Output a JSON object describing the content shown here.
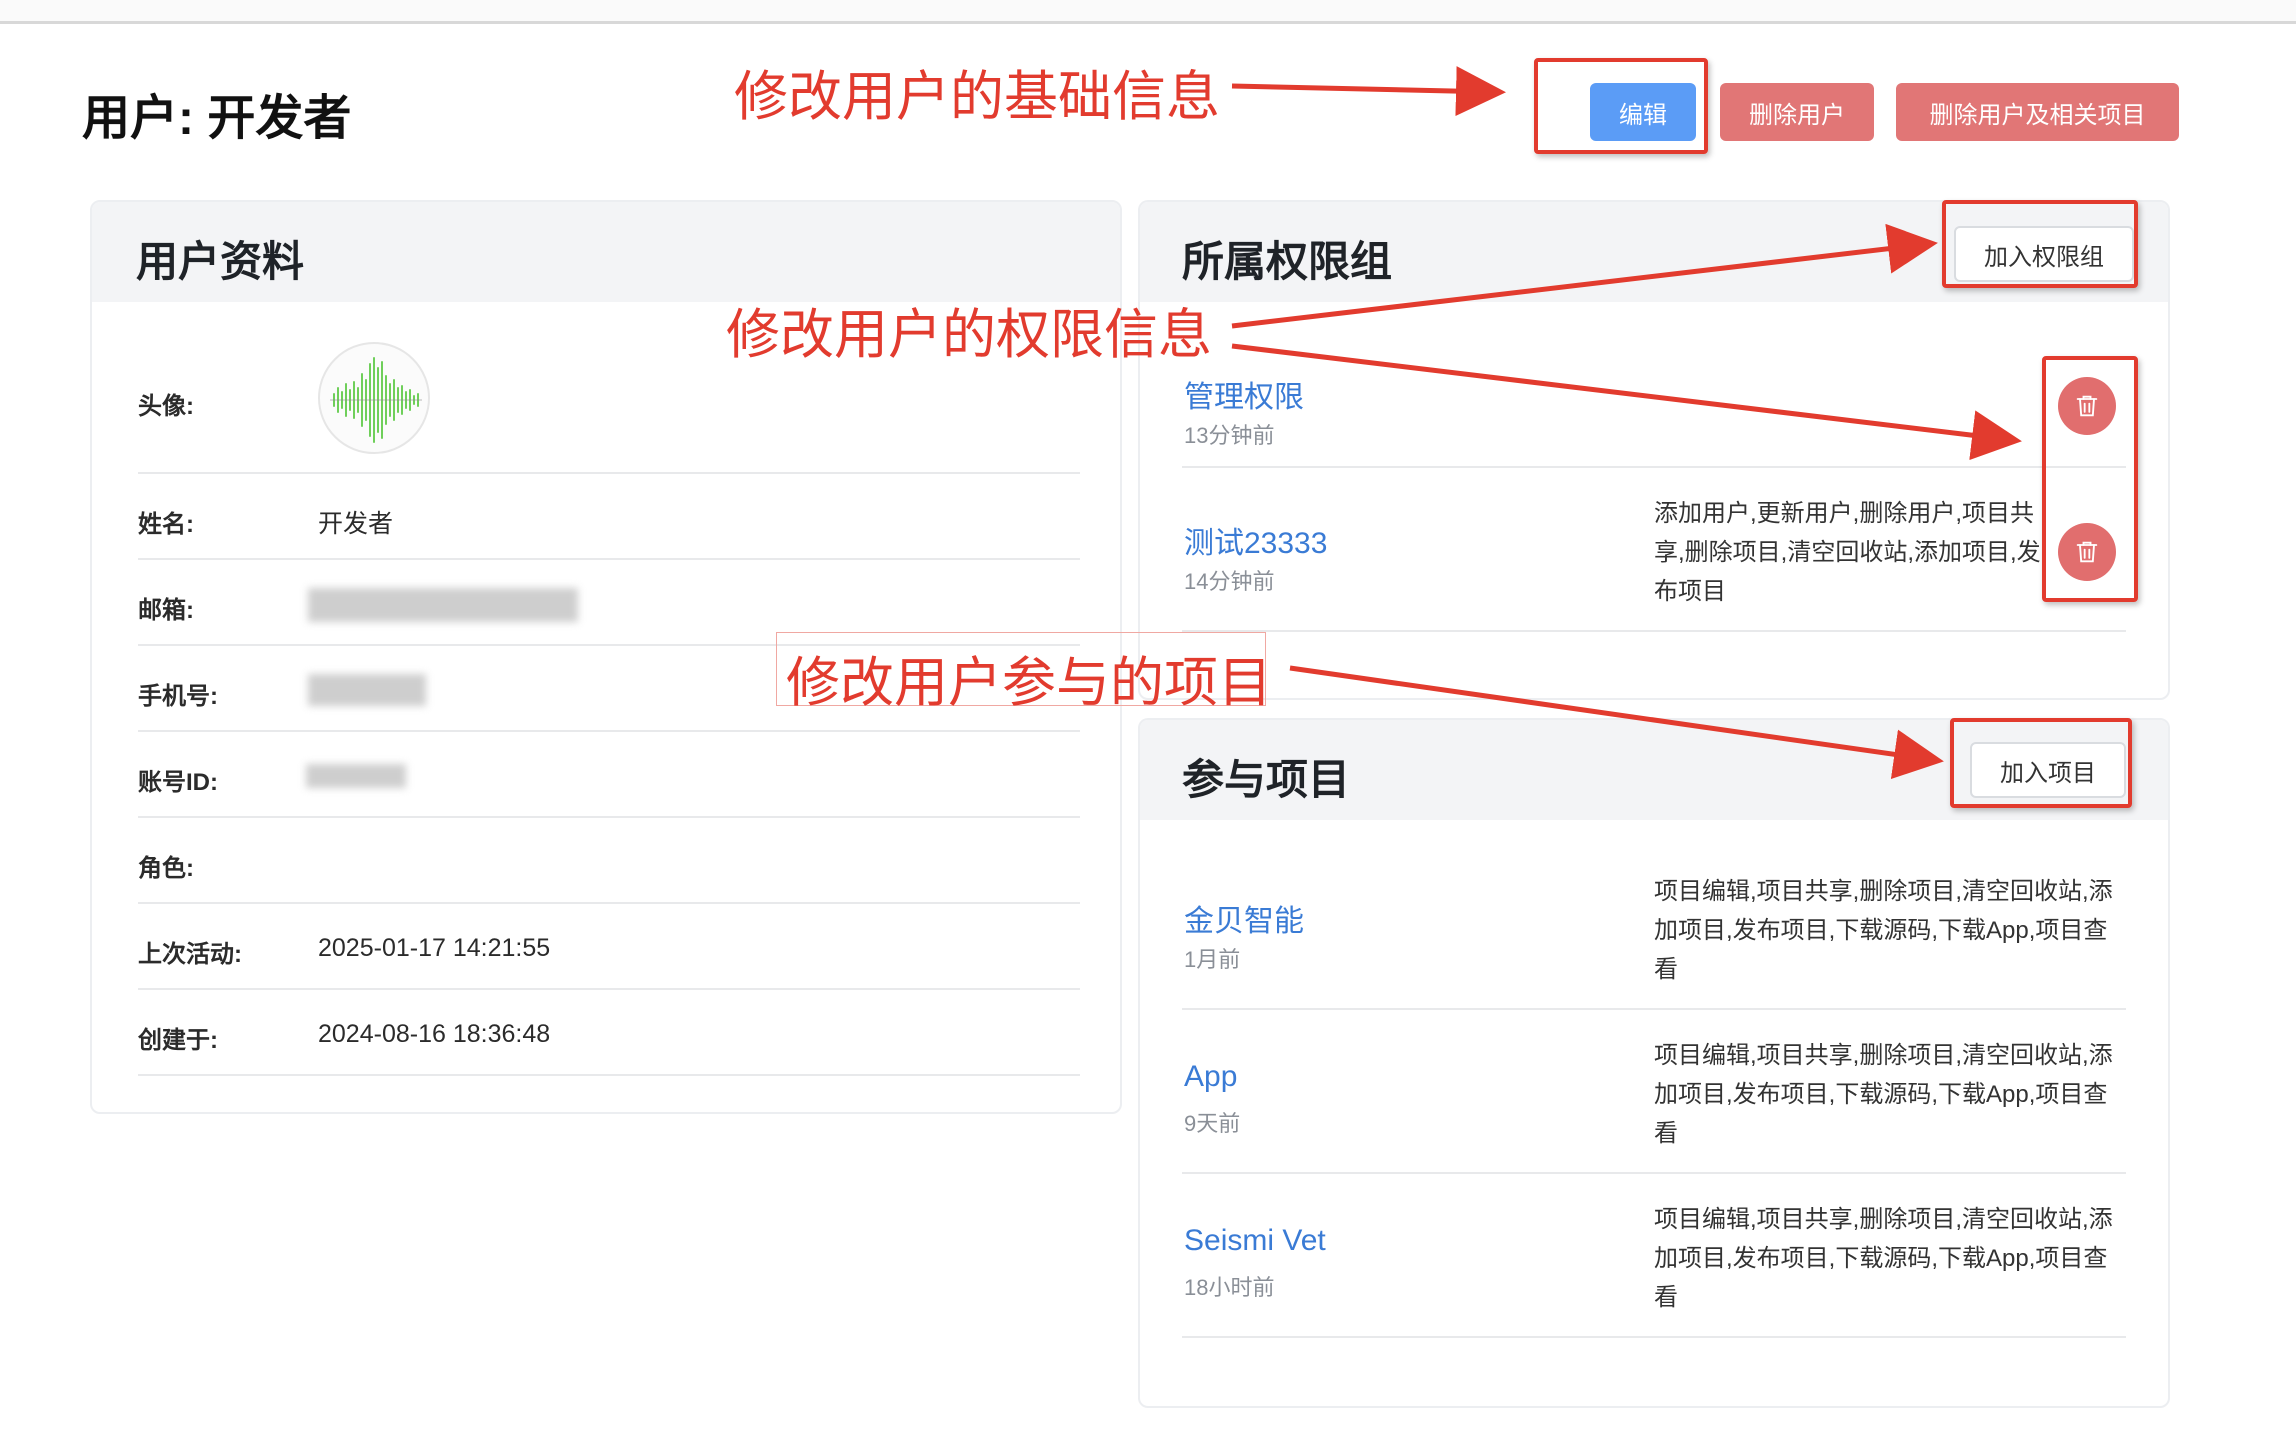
{
  "page": {
    "title": "用户: 开发者",
    "actions": {
      "edit": "编辑",
      "delete_user": "删除用户",
      "delete_user_projects": "删除用户及相关项目"
    }
  },
  "profile": {
    "title": "用户资料",
    "avatar_label": "头像:",
    "name_label": "姓名:",
    "name_value": "开发者",
    "email_label": "邮箱:",
    "phone_label": "手机号:",
    "account_label": "账号ID:",
    "role_label": "角色:",
    "last_active_label": "上次活动:",
    "last_active_value": "2025-01-17 14:21:55",
    "created_label": "创建于:",
    "created_value": "2024-08-16 18:36:48"
  },
  "groups": {
    "title": "所属权限组",
    "add_button": "加入权限组",
    "items": [
      {
        "name": "管理权限",
        "time": "13分钟前",
        "perms": ""
      },
      {
        "name": "测试23333",
        "time": "14分钟前",
        "perms": "添加用户,更新用户,删除用户,项目共享,删除项目,清空回收站,添加项目,发布项目"
      }
    ]
  },
  "projects": {
    "title": "参与项目",
    "add_button": "加入项目",
    "items": [
      {
        "name": "金贝智能",
        "time": "1月前",
        "perms": "项目编辑,项目共享,删除项目,清空回收站,添加项目,发布项目,下载源码,下载App,项目查看"
      },
      {
        "name": "App",
        "time": "9天前",
        "perms": "项目编辑,项目共享,删除项目,清空回收站,添加项目,发布项目,下载源码,下载App,项目查看"
      },
      {
        "name": "Seismi Vet",
        "time": "18小时前",
        "perms": "项目编辑,项目共享,删除项目,清空回收站,添加项目,发布项目,下载源码,下载App,项目查看"
      }
    ]
  },
  "annotations": {
    "basic_info": "修改用户的基础信息",
    "permission_info": "修改用户的权限信息",
    "projects_info": "修改用户参与的项目"
  },
  "colors": {
    "primary": "#5b9cf6",
    "danger": "#e17676",
    "link": "#3a7bd5",
    "annotation": "#e23b2e"
  },
  "icons": {
    "avatar": "waveform-icon",
    "delete": "trash-icon"
  }
}
